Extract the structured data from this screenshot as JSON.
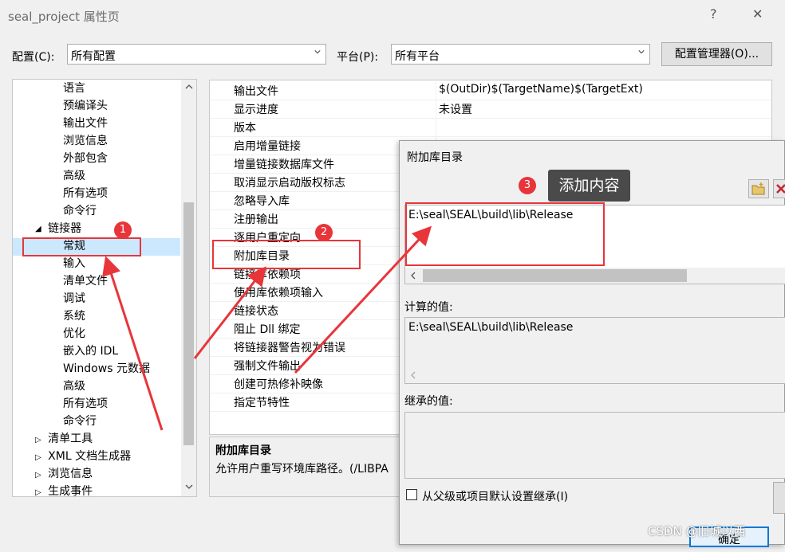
{
  "window": {
    "title": "seal_project 属性页",
    "help": "?",
    "close": "✕"
  },
  "toolbar": {
    "config_label": "配置(C):",
    "config_value": "所有配置",
    "platform_label": "平台(P):",
    "platform_value": "所有平台",
    "manager_button": "配置管理器(O)..."
  },
  "tree": {
    "items": [
      "语言",
      "预编译头",
      "输出文件",
      "浏览信息",
      "外部包含",
      "高级",
      "所有选项",
      "命令行",
      "链接器",
      "常规",
      "输入",
      "清单文件",
      "调试",
      "系统",
      "优化",
      "嵌入的 IDL",
      "Windows 元数据",
      "高级",
      "所有选项",
      "命令行",
      "清单工具",
      "XML 文档生成器",
      "浏览信息",
      "生成事件"
    ]
  },
  "props": {
    "rows": [
      {
        "name": "输出文件",
        "value": "$(OutDir)$(TargetName)$(TargetExt)"
      },
      {
        "name": "显示进度",
        "value": "未设置"
      },
      {
        "name": "版本",
        "value": ""
      },
      {
        "name": "启用增量链接",
        "value": ""
      },
      {
        "name": "增量链接数据库文件",
        "value": ""
      },
      {
        "name": "取消显示启动版权标志",
        "value": ""
      },
      {
        "name": "忽略导入库",
        "value": ""
      },
      {
        "name": "注册输出",
        "value": ""
      },
      {
        "name": "逐用户重定向",
        "value": ""
      },
      {
        "name": "附加库目录",
        "value": ""
      },
      {
        "name": "链接库依赖项",
        "value": ""
      },
      {
        "name": "使用库依赖项输入",
        "value": ""
      },
      {
        "name": "链接状态",
        "value": ""
      },
      {
        "name": "阻止 Dll 绑定",
        "value": ""
      },
      {
        "name": "将链接器警告视为错误",
        "value": ""
      },
      {
        "name": "强制文件输出",
        "value": ""
      },
      {
        "name": "创建可热修补映像",
        "value": ""
      },
      {
        "name": "指定节特性",
        "value": ""
      }
    ],
    "desc_title": "附加库目录",
    "desc_text": "允许用户重写环境库路径。(/LIBPA"
  },
  "dialog": {
    "title": "附加库目录",
    "entry": "E:\\seal\\SEAL\\build\\lib\\Release",
    "computed_label": "计算的值:",
    "computed_value": "E:\\seal\\SEAL\\build\\lib\\Release",
    "inherited_label": "继承的值:",
    "inherit_checkbox": "从父级或项目默认设置继承(I)",
    "ok_button": "确定"
  },
  "annotations": {
    "badge1": "1",
    "badge2": "2",
    "badge3": "3",
    "tooltip3": "添加内容",
    "accent": "#e8353a"
  },
  "watermark": "CSDN @旧城以西"
}
